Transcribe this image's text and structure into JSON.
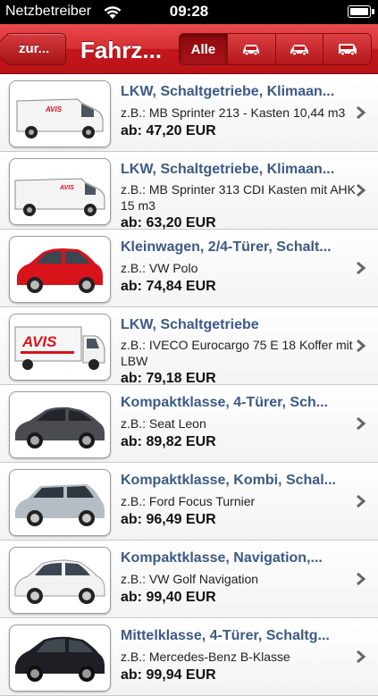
{
  "status_bar": {
    "carrier": "Netzbetreiber",
    "time": "09:28"
  },
  "navbar": {
    "back_label": "zur...",
    "title": "Fahrz...",
    "segments": [
      {
        "label": "Alle",
        "icon": "all-label",
        "active": true
      },
      {
        "label": "",
        "icon": "car-icon",
        "active": false
      },
      {
        "label": "",
        "icon": "car-icon",
        "active": false
      },
      {
        "label": "",
        "icon": "van-icon",
        "active": false
      }
    ]
  },
  "vehicles": [
    {
      "title": "LKW, Schaltgetriebe, Klimaan...",
      "example": "z.B.: MB Sprinter 213 - Kasten 10,44 m3",
      "price": "ab: 47,20 EUR",
      "image": "van-icon"
    },
    {
      "title": "LKW, Schaltgetriebe, Klimaan...",
      "example": "z.B.: MB Sprinter 313 CDI Kasten mit AHK 15 m3",
      "price": "ab: 63,20 EUR",
      "image": "van-icon"
    },
    {
      "title": "Kleinwagen, 2/4-Türer, Schalt...",
      "example": "z.B.: VW Polo",
      "price": "ab: 74,84 EUR",
      "image": "red-car-icon"
    },
    {
      "title": "LKW, Schaltgetriebe",
      "example": "z.B.: IVECO Eurocargo 75 E 18 Koffer mit LBW",
      "price": "ab: 79,18 EUR",
      "image": "truck-icon"
    },
    {
      "title": "Kompaktklasse, 4-Türer, Sch...",
      "example": "z.B.: Seat Leon",
      "price": "ab: 89,82 EUR",
      "image": "dark-car-icon"
    },
    {
      "title": "Kompaktklasse, Kombi, Schal...",
      "example": "z.B.: Ford Focus Turnier",
      "price": "ab: 96,49 EUR",
      "image": "wagon-icon"
    },
    {
      "title": "Kompaktklasse, Navigation,...",
      "example": "z.B.: VW Golf Navigation",
      "price": "ab: 99,40 EUR",
      "image": "white-car-icon"
    },
    {
      "title": "Mittelklasse, 4-Türer, Schaltg...",
      "example": "z.B.: Mercedes-Benz B-Klasse",
      "price": "ab: 99,94 EUR",
      "image": "black-car-icon"
    }
  ],
  "colors": {
    "nav_red": "#d72e32",
    "title_blue": "#3c5a86",
    "avis_red": "#d8141a"
  }
}
